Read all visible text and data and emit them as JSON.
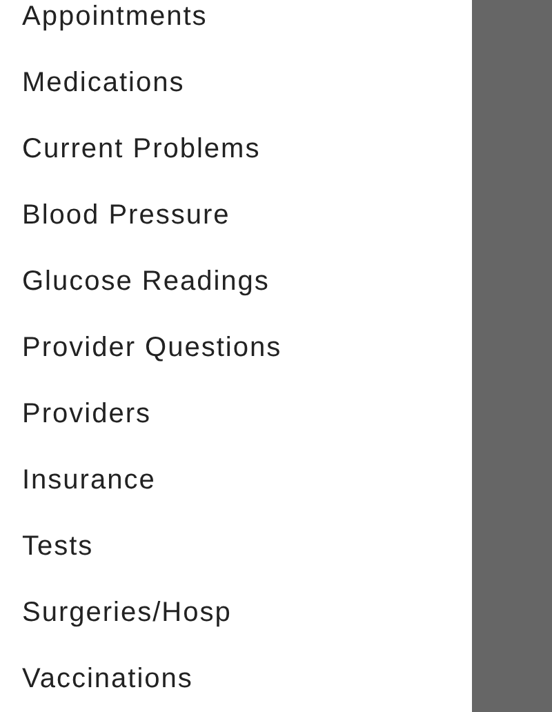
{
  "drawer": {
    "items": [
      {
        "label": "Appointments"
      },
      {
        "label": "Medications"
      },
      {
        "label": "Current Problems"
      },
      {
        "label": "Blood Pressure"
      },
      {
        "label": "Glucose Readings"
      },
      {
        "label": "Provider Questions"
      },
      {
        "label": "Providers"
      },
      {
        "label": "Insurance"
      },
      {
        "label": "Tests"
      },
      {
        "label": "Surgeries/Hosp"
      },
      {
        "label": "Vaccinations"
      }
    ]
  }
}
